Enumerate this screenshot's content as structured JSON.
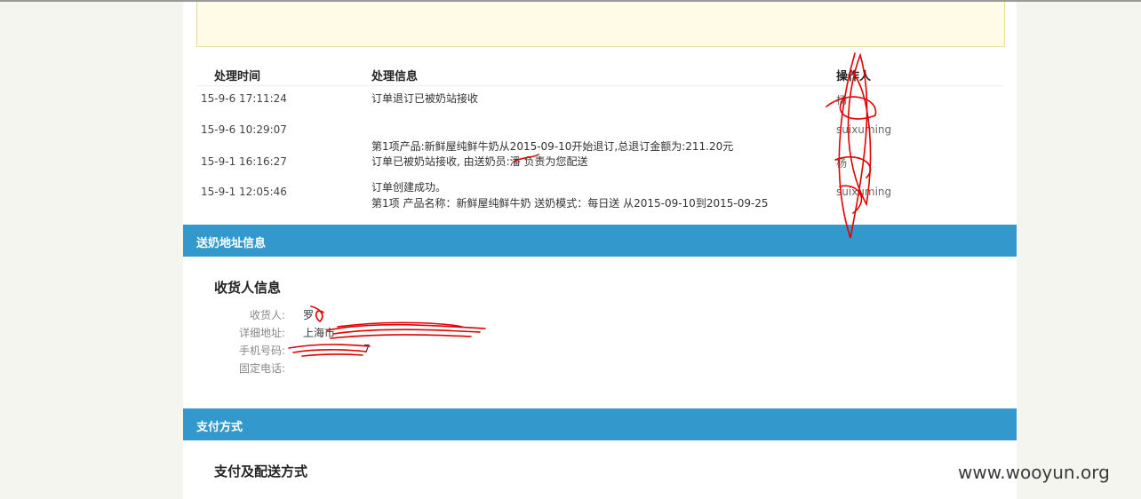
{
  "log": {
    "headers": {
      "time": "处理时间",
      "info": "处理信息",
      "operator": "操作人"
    },
    "rows": [
      {
        "time": "15-9-6 17:11:24",
        "info": "订单退订已被奶站接收",
        "operator": "杨"
      },
      {
        "time": "15-9-6 10:29:07",
        "info": "第1项产品:新鲜屋纯鲜牛奶从2015-09-10开始退订,总退订金额为:211.20元",
        "operator": "suixuming"
      },
      {
        "time": "15-9-1 16:16:27",
        "info": "订单已被奶站接收, 由送奶员:潘 负责为您配送",
        "operator": "杨"
      },
      {
        "time": "15-9-1 12:05:46",
        "info_line1": "订单创建成功。",
        "info_line2": "第1项 产品名称：新鲜屋纯鲜牛奶 送奶模式：每日送 从2015-09-10到2015-09-25",
        "operator": "suixuming"
      }
    ]
  },
  "address_section": {
    "title": "送奶地址信息",
    "subtitle": "收货人信息",
    "fields": [
      {
        "label": "收货人:",
        "value": "罗"
      },
      {
        "label": "详细地址:",
        "value": "上海市"
      },
      {
        "label": "手机号码:",
        "value": "7"
      },
      {
        "label": "固定电话:",
        "value": ""
      }
    ]
  },
  "payment_section": {
    "title": "支付方式",
    "subtitle": "支付及配送方式"
  },
  "watermark": "www.wooyun.org",
  "colors": {
    "section_bar": "#3399cc",
    "redaction": "#e00000",
    "notice_bg": "#fffbe6"
  }
}
